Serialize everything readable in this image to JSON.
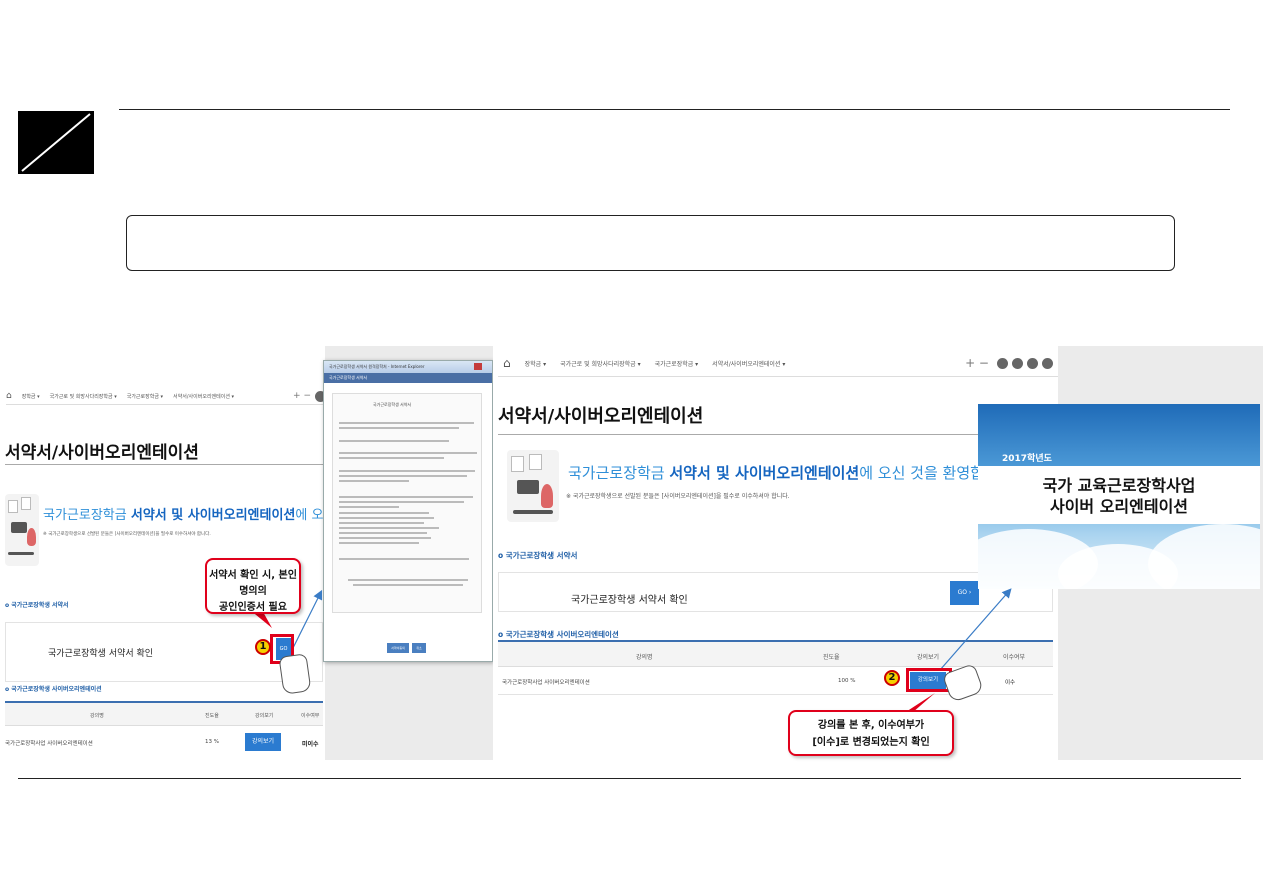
{
  "panel_a": {
    "nav": {
      "home_icon": "home-icon",
      "items": [
        "장학금 ▾",
        "국가근로 및 희망사다리장학금 ▾",
        "국가근로장학금 ▾",
        "서약서/사이버오리엔테이션 ▾"
      ],
      "tools": "+ −"
    },
    "heading": "서약서/사이버오리엔테이션",
    "welcome": {
      "prefix": "국가근로장학금 ",
      "bold": "서약서 및 사이버오리엔테이션",
      "suffix": "에 오신 것을 환영합니다."
    },
    "sub_note": "※ 국가근로장학생으로 선발된 분들은 [사이버오리엔테이션]을 필수로 이수하셔야 합니다.",
    "section_pledge": "국가근로장학생 서약서",
    "pledge_label": "국가근로장학생 서약서 확인",
    "go_button": "GO",
    "section_cyber": "국가근로장학생 사이버오리엔테이션",
    "table_headers": [
      "강의명",
      "진도율",
      "강의보기",
      "이수여부"
    ],
    "table_row": {
      "name": "국가근로장학사업 사이버오리엔테이션",
      "progress": "13 %",
      "button": "강의보기",
      "status": "미이수"
    }
  },
  "dialog": {
    "title": "국가근로장학생 서약서 원격장학처 - Internet Explorer",
    "subtitle": "국가근로장학생 서약서",
    "body_title": "국가근로장학생 서약서",
    "buttons": [
      "서약서동의",
      "취소"
    ]
  },
  "callout_1": {
    "marker": "1",
    "line1": "서약서 확인 시, 본인명의의",
    "line2": "공인인증서 필요"
  },
  "panel_b": {
    "nav": {
      "home_icon": "home-icon",
      "items": [
        "장학금 ▾",
        "국가근로 및 희망사다리장학금 ▾",
        "국가근로장학금 ▾",
        "서약서/사이버오리엔테이션 ▾"
      ],
      "tools": "+ −"
    },
    "heading": "서약서/사이버오리엔테이션",
    "welcome": {
      "prefix": "국가근로장학금 ",
      "bold": "서약서 및 사이버오리엔테이션",
      "suffix": "에 오신 것을 환영합니"
    },
    "sub_note": "※ 국가근로장학생으로 선발된 분들은 [사이버오리엔테이션]을 필수로 이수하셔야 합니다.",
    "section_pledge": "국가근로장학생 서약서",
    "pledge_label": "국가근로장학생 서약서 확인",
    "go_button": "GO ›",
    "section_cyber": "국가근로장학생 사이버오리엔테이션",
    "table_headers": [
      "강의명",
      "진도율",
      "강의보기",
      "이수여부"
    ],
    "table_row": {
      "name": "국가근로장학사업 사이버오리엔테이션",
      "progress": "100 %",
      "button": "강의보기",
      "status": "이수"
    }
  },
  "cyber_card": {
    "year": "2017학년도",
    "title1": "국가 교육근로장학사업",
    "title2": "사이버 오리엔테이션"
  },
  "callout_2": {
    "marker": "2",
    "line1": "강의를 본 후, 이수여부가",
    "line2": "[이수]로 변경되었는지 확인"
  },
  "colors": {
    "accent_blue": "#2b7bd0",
    "callout_red": "#e0001b",
    "marker_yellow": "#f5d000",
    "section_blue": "#1e5ea6"
  }
}
